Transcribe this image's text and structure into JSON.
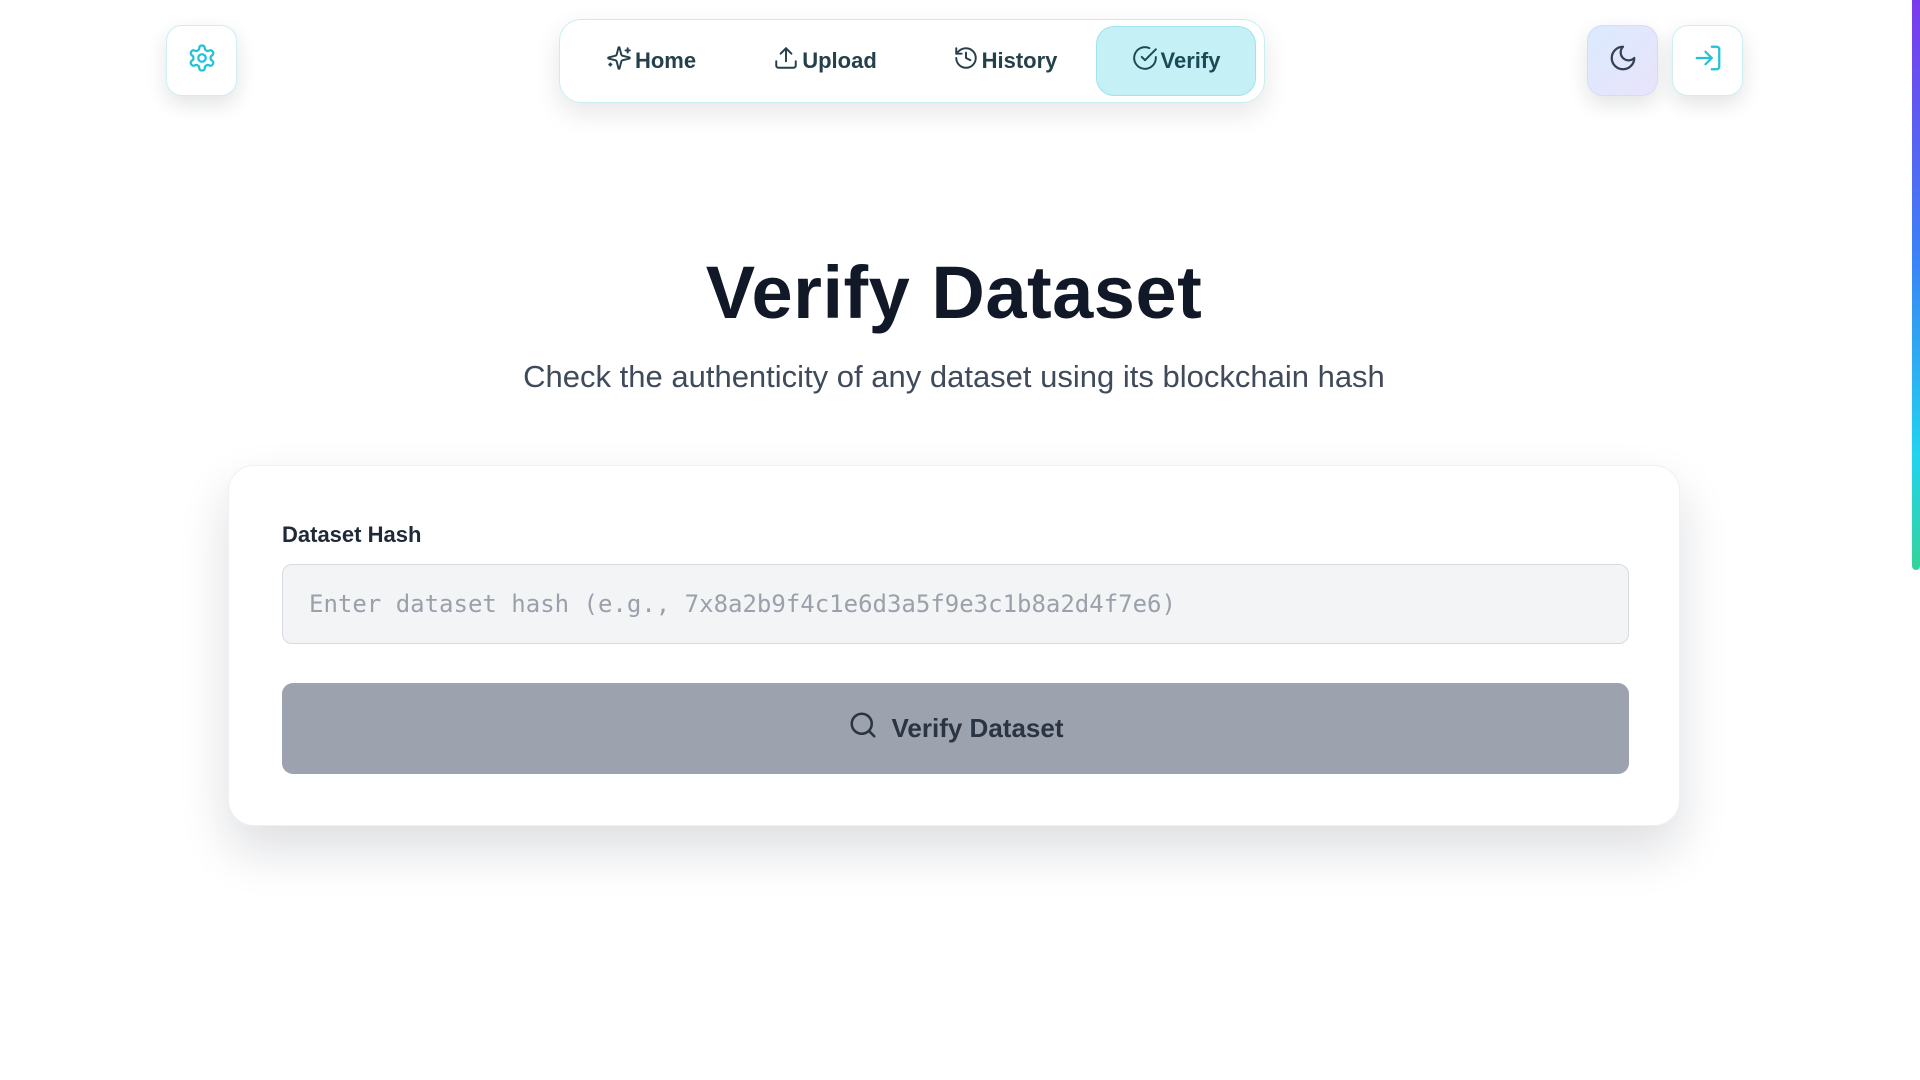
{
  "nav": {
    "items": [
      {
        "label": "Home",
        "icon": "sparkles-icon"
      },
      {
        "label": "Upload",
        "icon": "upload-icon"
      },
      {
        "label": "History",
        "icon": "history-icon"
      },
      {
        "label": "Verify",
        "icon": "check-circle-icon",
        "active": true
      }
    ]
  },
  "header": {
    "settings_icon": "gear-icon",
    "theme_icon": "moon-icon",
    "login_icon": "log-in-icon"
  },
  "main": {
    "title": "Verify Dataset",
    "subtitle": "Check the authenticity of any dataset using its blockchain hash"
  },
  "form": {
    "label": "Dataset Hash",
    "input_value": "",
    "input_placeholder": "Enter dataset hash (e.g., 7x8a2b9f4c1e6d3a5f9e3c1b8a2d4f7e6)",
    "button_label": "Verify Dataset",
    "button_icon": "search-icon"
  },
  "colors": {
    "accent": "#22c3d6",
    "active_tab_bg": "#c5f0f6",
    "button_disabled": "#9ca3ae"
  }
}
